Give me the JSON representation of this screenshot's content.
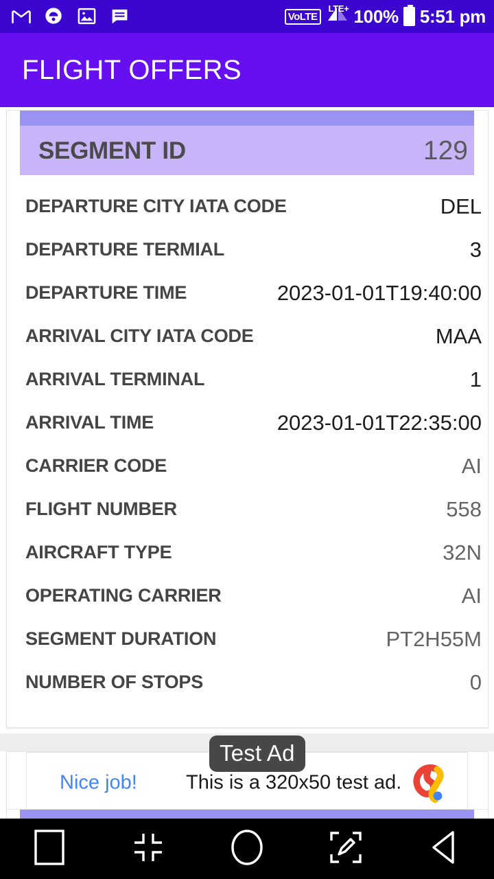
{
  "status_bar": {
    "icons": [
      "gmail-icon",
      "truecaller-icon",
      "photos-icon",
      "messages-icon"
    ],
    "volte": "VoLTE",
    "network": "LTE+",
    "battery_percent": "100%",
    "battery_icon": "battery-full-icon",
    "time": "5:51 pm",
    "background_color": "#3a06d0"
  },
  "app_bar": {
    "title": "FLIGHT OFFERS",
    "background_color": "#6610f2",
    "text_color": "#ffffff"
  },
  "segment_card": {
    "header": {
      "label": "SEGMENT ID",
      "value": "129",
      "background_color": "#c8b4f8",
      "strip_color": "#9b93f2"
    },
    "rows": [
      {
        "label": "DEPARTURE CITY IATA CODE",
        "value": "DEL",
        "value_style": "dark"
      },
      {
        "label": "DEPARTURE TERMIAL",
        "value": "3",
        "value_style": "dark"
      },
      {
        "label": "DEPARTURE TIME",
        "value": "2023-01-01T19:40:00",
        "value_style": "dark"
      },
      {
        "label": "ARRIVAL CITY IATA CODE",
        "value": "MAA",
        "value_style": "dark"
      },
      {
        "label": "ARRIVAL TERMINAL",
        "value": "1",
        "value_style": "dark"
      },
      {
        "label": "ARRIVAL TIME",
        "value": "2023-01-01T22:35:00",
        "value_style": "dark"
      },
      {
        "label": "CARRIER CODE",
        "value": "AI",
        "value_style": "gray"
      },
      {
        "label": "FLIGHT NUMBER",
        "value": "558",
        "value_style": "gray"
      },
      {
        "label": "AIRCRAFT TYPE",
        "value": "32N",
        "value_style": "gray"
      },
      {
        "label": "OPERATING CARRIER",
        "value": "AI",
        "value_style": "gray"
      },
      {
        "label": "SEGMENT DURATION",
        "value": "PT2H55M",
        "value_style": "gray"
      },
      {
        "label": "NUMBER OF STOPS",
        "value": "0",
        "value_style": "gray"
      }
    ]
  },
  "ad": {
    "badge": "Test Ad",
    "link_text": "Nice job!",
    "body_text": "This is a 320x50 test ad.",
    "logo": "admob-logo",
    "link_color": "#4285f4",
    "badge_color": "#474747"
  },
  "nav_bar": {
    "buttons": [
      {
        "name": "recents-button",
        "icon": "square-icon"
      },
      {
        "name": "shrink-button",
        "icon": "collapse-arrows-icon"
      },
      {
        "name": "home-button",
        "icon": "circle-icon"
      },
      {
        "name": "screenshot-button",
        "icon": "pencil-crop-icon"
      },
      {
        "name": "back-button",
        "icon": "back-triangle-icon"
      }
    ],
    "background_color": "#000000"
  }
}
